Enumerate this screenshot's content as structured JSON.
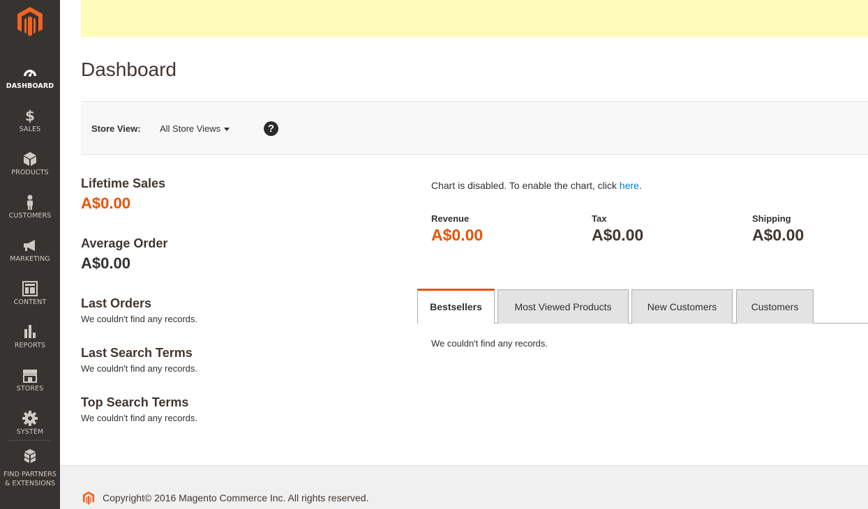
{
  "colors": {
    "sidebar_bg": "#373330",
    "accent": "#eb5202",
    "notice_bg": "#fffbbb",
    "link": "#007bdb"
  },
  "sidebar": {
    "logo": "magento-logo",
    "items": [
      {
        "label": "DASHBOARD",
        "icon": "dashboard-icon",
        "active": true
      },
      {
        "label": "SALES",
        "icon": "dollar-icon"
      },
      {
        "label": "PRODUCTS",
        "icon": "box-icon"
      },
      {
        "label": "CUSTOMERS",
        "icon": "person-icon"
      },
      {
        "label": "MARKETING",
        "icon": "megaphone-icon"
      },
      {
        "label": "CONTENT",
        "icon": "layout-icon"
      },
      {
        "label": "REPORTS",
        "icon": "bar-chart-icon"
      },
      {
        "label": "STORES",
        "icon": "store-icon"
      },
      {
        "label": "SYSTEM",
        "icon": "gear-icon"
      }
    ],
    "partners": {
      "line1": "FIND PARTNERS",
      "line2": "& EXTENSIONS",
      "icon": "cubes-icon"
    }
  },
  "page": {
    "title": "Dashboard"
  },
  "store_view": {
    "label": "Store View:",
    "value": "All Store Views",
    "help": "?"
  },
  "left": {
    "lifetime_sales": {
      "title": "Lifetime Sales",
      "value": "A$0.00"
    },
    "average_order": {
      "title": "Average Order",
      "value": "A$0.00"
    },
    "last_orders": {
      "title": "Last Orders",
      "empty": "We couldn't find any records."
    },
    "last_search_terms": {
      "title": "Last Search Terms",
      "empty": "We couldn't find any records."
    },
    "top_search_terms": {
      "title": "Top Search Terms",
      "empty": "We couldn't find any records."
    }
  },
  "chart": {
    "message": "Chart is disabled. To enable the chart, click ",
    "link": "here",
    "period": "."
  },
  "totals": [
    {
      "label": "Revenue",
      "value": "A$0.00"
    },
    {
      "label": "Tax",
      "value": "A$0.00"
    },
    {
      "label": "Shipping",
      "value": "A$0.00"
    }
  ],
  "tabs": [
    {
      "label": "Bestsellers",
      "active": true
    },
    {
      "label": "Most Viewed Products"
    },
    {
      "label": "New Customers"
    },
    {
      "label": "Customers"
    }
  ],
  "tab_content": {
    "empty": "We couldn't find any records."
  },
  "footer": {
    "copyright": "Copyright© 2016 Magento Commerce Inc. All rights reserved."
  }
}
